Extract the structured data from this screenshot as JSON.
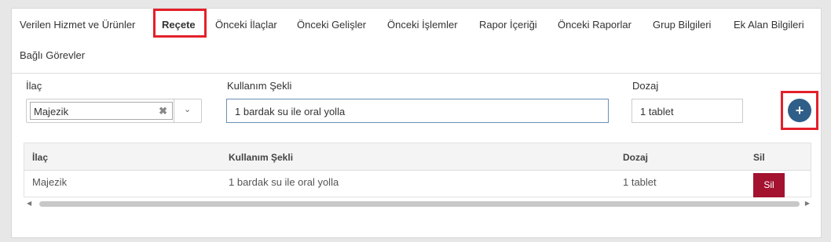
{
  "tabs": [
    {
      "label": "Verilen Hizmet ve Ürünler",
      "active": false
    },
    {
      "label": "Reçete",
      "active": true
    },
    {
      "label": "Önceki İlaçlar",
      "active": false
    },
    {
      "label": "Önceki Gelişler",
      "active": false
    },
    {
      "label": "Önceki İşlemler",
      "active": false
    },
    {
      "label": "Rapor İçeriği",
      "active": false
    },
    {
      "label": "Önceki Raporlar",
      "active": false
    },
    {
      "label": "Grup Bilgileri",
      "active": false
    },
    {
      "label": "Ek Alan Bilgileri",
      "active": false
    },
    {
      "label": "Bağlı Görevler",
      "active": false
    }
  ],
  "form": {
    "ilac_label": "İlaç",
    "ilac_value": "Majezik",
    "ilac_clear": "✖",
    "kullanim_label": "Kullanım Şekli",
    "kullanim_value": "1 bardak su ile oral yolla",
    "dozaj_label": "Dozaj",
    "dozaj_value": "1 tablet",
    "add_button": "+"
  },
  "table": {
    "headers": [
      "İlaç",
      "Kullanım Şekli",
      "Dozaj",
      "Sil"
    ],
    "rows": [
      {
        "ilac": "Majezik",
        "kullanim": "1 bardak su ile oral yolla",
        "dozaj": "1 tablet",
        "sil": "Sil"
      }
    ]
  },
  "colors": {
    "highlight": "#e3202a",
    "add_button": "#2f5e88",
    "delete_button": "#a3122f"
  },
  "icons": {
    "dropdown": "chevron-down-icon",
    "clear": "close-icon",
    "add": "plus-icon",
    "scroll_left": "arrow-left-icon",
    "scroll_right": "arrow-right-icon"
  }
}
